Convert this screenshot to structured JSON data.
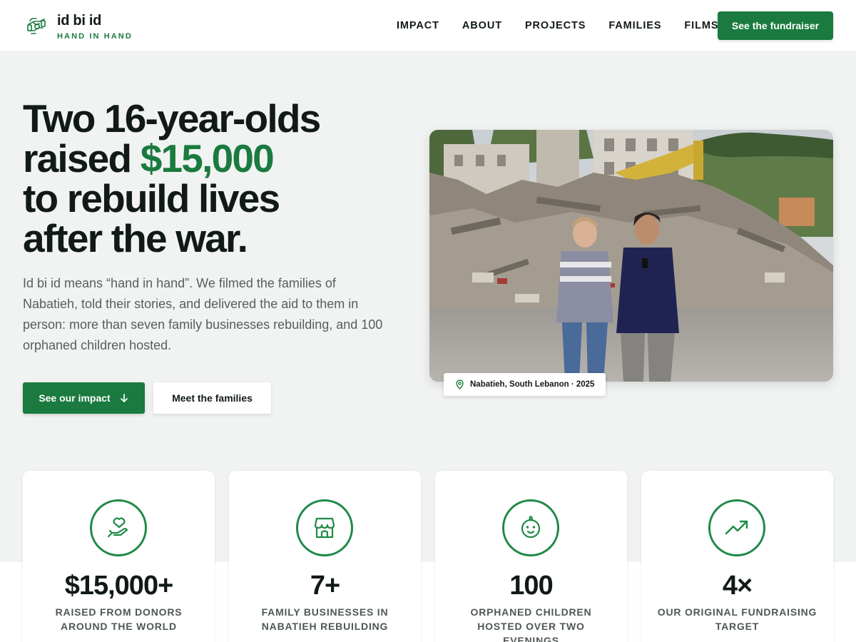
{
  "brand": {
    "name": "id bi id",
    "tagline": "HAND IN HAND",
    "logo_icon": "hand-in-hand-logo-icon"
  },
  "nav": {
    "links": [
      "IMPACT",
      "ABOUT",
      "PROJECTS",
      "FAMILIES",
      "FILMS"
    ],
    "cta_label": "See the fundraiser"
  },
  "hero": {
    "title_line1": "Two 16-year-olds",
    "title_raised": "raised",
    "title_amount": "$15,000",
    "title_line3": "to rebuild lives",
    "title_line4": "after the war.",
    "description": "Id bi id means “hand in hand”. We filmed the families of Nabatieh, told their stories, and delivered the aid to them in person: more than seven family businesses rebuilding, and 100 orphaned children hosted.",
    "primary_button": "See our impact",
    "secondary_button": "Meet the families",
    "photo_caption": "Nabatieh, South Lebanon · 2025"
  },
  "stats": [
    {
      "icon": "hand-heart-icon",
      "value": "$15,000+",
      "label": "Raised from donors around the world"
    },
    {
      "icon": "storefront-icon",
      "value": "7+",
      "label": "Family businesses in Nabatieh rebuilding"
    },
    {
      "icon": "baby-face-icon",
      "value": "100",
      "label": "Orphaned children hosted over two evenings"
    },
    {
      "icon": "trending-up-icon",
      "value": "4×",
      "label": "Our original fundraising target"
    }
  ],
  "colors": {
    "brand_green": "#1a7a3f",
    "icon_ring": "#1f8a46",
    "page_bg": "#f1f3f2",
    "text_dark": "#111a15"
  }
}
